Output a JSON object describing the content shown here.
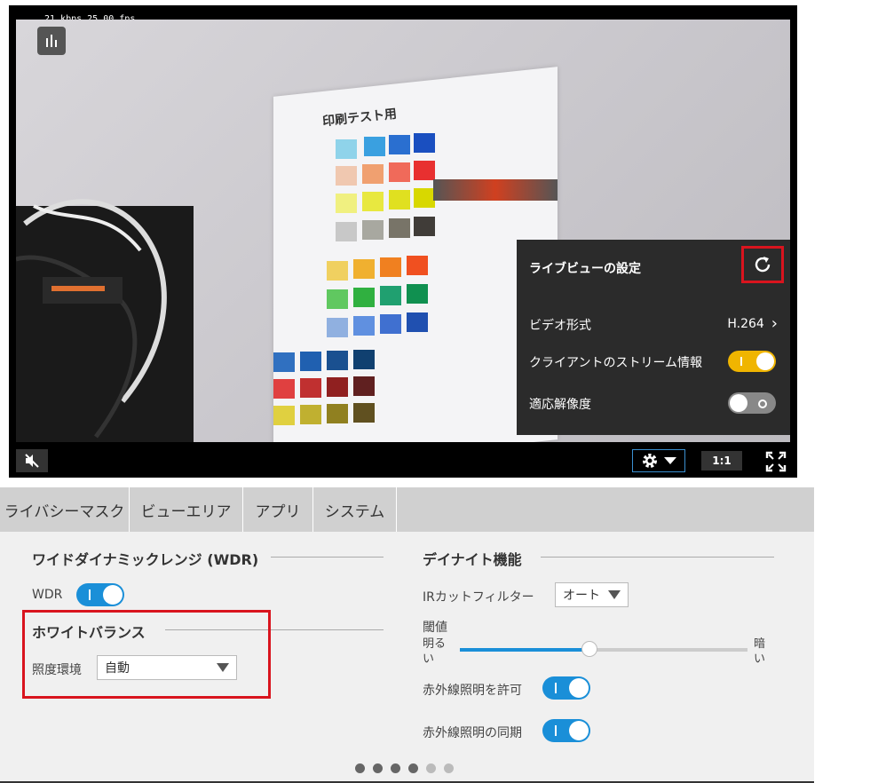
{
  "stats_text": "21 kbps 25.00 fps",
  "colors": {
    "accent": "#1a8fd8",
    "toggle_yellow": "#f0b500",
    "highlight": "#d9141e"
  },
  "video": {
    "paper_title": "印刷テスト用",
    "stats_icon": "bar-chart-icon"
  },
  "settings_panel": {
    "title": "ライブビューの設定",
    "reset_icon": "refresh-icon",
    "video_format_label": "ビデオ形式",
    "video_format_value": "H.264",
    "stream_info_label": "クライアントのストリーム情報",
    "stream_info_on": true,
    "adaptive_res_label": "適応解像度",
    "adaptive_res_on": false
  },
  "controls": {
    "mute_icon": "muted-speaker-icon",
    "gear_icon": "gear-icon",
    "ratio_label": "1:1",
    "fullscreen_icon": "fullscreen-icon"
  },
  "tabs": [
    {
      "label": "ライバシーマスク"
    },
    {
      "label": "ビューエリア"
    },
    {
      "label": "アプリ"
    },
    {
      "label": "システム"
    }
  ],
  "wdr": {
    "title": "ワイドダイナミックレンジ (WDR)",
    "label": "WDR",
    "on": true
  },
  "white_balance": {
    "title": "ホワイトバランス",
    "env_label": "照度環境",
    "env_value": "自動"
  },
  "day_night": {
    "title": "デイナイト機能",
    "ir_filter_label": "IRカットフィルター",
    "ir_filter_value": "オート",
    "threshold_label": "閾値",
    "bright_label_1": "明る",
    "bright_label_2": "い",
    "dark_label_1": "暗",
    "dark_label_2": "い",
    "threshold_value": 0.45,
    "ir_allow_label": "赤外線照明を許可",
    "ir_allow_on": true,
    "ir_sync_label": "赤外線照明の同期",
    "ir_sync_on": true
  },
  "pagination": {
    "total": 6,
    "active_count": 4
  }
}
